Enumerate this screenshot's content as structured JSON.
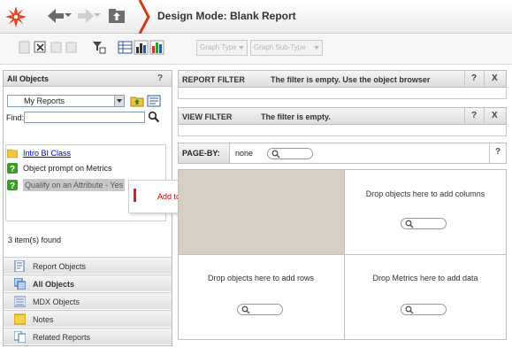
{
  "header": {
    "breadcrumb_title": "Design Mode: Blank Report"
  },
  "toolbar": {
    "graph_type_label": "Graph Type",
    "graph_subtype_label": "Graph Sub-Type"
  },
  "left_panel": {
    "title": "All Objects",
    "help": "?",
    "folder": "My Reports",
    "find_label": "Find:",
    "find_value": "",
    "items": [
      {
        "label": "Intro BI Class",
        "icon": "folder-icon"
      },
      {
        "label": "Object prompt on Metrics",
        "icon": "prompt-icon"
      },
      {
        "label": "Qualify on an Attribute - Yes",
        "icon": "prompt-icon"
      }
    ],
    "context_menu": {
      "item": "Add to Filter"
    },
    "items_found": "3 item(s) found",
    "nav": [
      {
        "label": "Report Objects",
        "icon": "report-objects-icon",
        "bold": false
      },
      {
        "label": "All Objects",
        "icon": "all-objects-icon",
        "bold": true
      },
      {
        "label": "MDX Objects",
        "icon": "mdx-objects-icon",
        "bold": false
      },
      {
        "label": "Notes",
        "icon": "notes-icon",
        "bold": false
      },
      {
        "label": "Related Reports",
        "icon": "related-reports-icon",
        "bold": false
      }
    ]
  },
  "report_filter": {
    "title": "REPORT FILTER",
    "message": "The filter is empty. Use the object browser",
    "help": "?",
    "close": "X"
  },
  "view_filter": {
    "title": "VIEW FILTER",
    "message": "The filter is empty.",
    "help": "?",
    "close": "X"
  },
  "page_by": {
    "label": "PAGE-BY:",
    "value": "none",
    "help": "?"
  },
  "grid": {
    "columns_text": "Drop objects here to add columns",
    "rows_text": "Drop objects here to add rows",
    "data_text": "Drop Metrics here to add data"
  },
  "colors": {
    "accent_red": "#e02020",
    "corner_cell": "#d6d0c4",
    "link_blue": "#0000cc"
  }
}
